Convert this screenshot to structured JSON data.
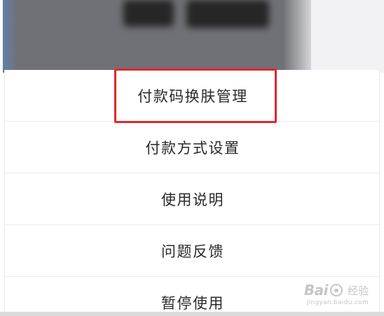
{
  "menu": {
    "items": [
      {
        "label": "付款码换肤管理",
        "highlighted": true
      },
      {
        "label": "付款方式设置",
        "highlighted": false
      },
      {
        "label": "使用说明",
        "highlighted": false
      },
      {
        "label": "问题反馈",
        "highlighted": false
      },
      {
        "label": "暂停使用",
        "highlighted": false
      }
    ]
  },
  "highlight": {
    "color": "#e4262c"
  },
  "watermark": {
    "brand_prefix": "Bai",
    "brand_suffix": "经验",
    "url": "jingyan.baidu.com"
  }
}
